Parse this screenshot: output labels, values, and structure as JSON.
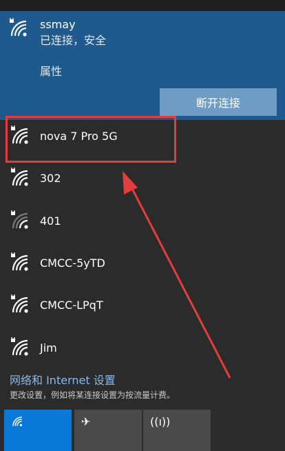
{
  "connected": {
    "name": "ssmay",
    "status": "已连接，安全",
    "properties": "属性",
    "disconnect": "断开连接"
  },
  "networks": [
    {
      "name": "nova 7 Pro 5G"
    },
    {
      "name": "302"
    },
    {
      "name": "401"
    },
    {
      "name": "CMCC-5yTD"
    },
    {
      "name": "CMCC-LPqT"
    },
    {
      "name": "Jim"
    }
  ],
  "settings": {
    "link": "网络和 Internet 设置",
    "desc": "更改设置，例如将某连接设置为按流量计费。"
  },
  "tiles": [
    {
      "label": "",
      "icon": "wifi-icon",
      "active": true
    },
    {
      "label": "",
      "icon": "airplane-icon"
    },
    {
      "label": "",
      "icon": "mobile-hotspot-icon"
    }
  ],
  "colors": {
    "panel": "#2b2b2b",
    "connected_bg": "#1f5a8f",
    "accent": "#0a78d7",
    "highlight": "#e33d3d"
  }
}
